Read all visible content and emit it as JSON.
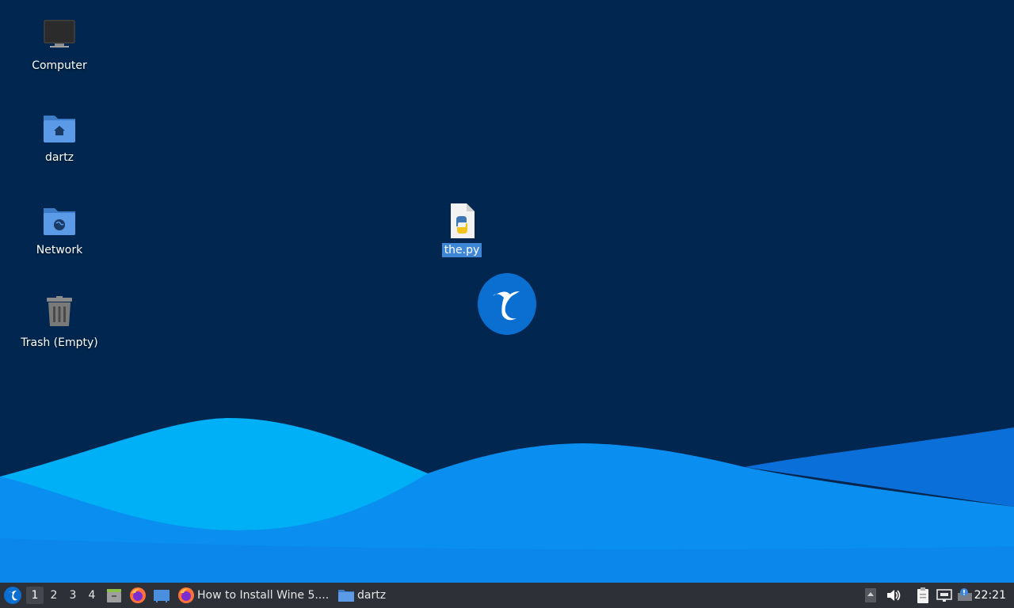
{
  "desktop": {
    "icons": [
      {
        "label": "Computer",
        "icon": "computer-icon"
      },
      {
        "label": "dartz",
        "icon": "home-folder-icon"
      },
      {
        "label": "Network",
        "icon": "network-folder-icon"
      },
      {
        "label": "Trash (Empty)",
        "icon": "trash-icon"
      },
      {
        "label": "the.py",
        "icon": "python-file-icon",
        "selected": true
      }
    ],
    "logo": "hummingbird-logo-icon",
    "colors": {
      "background": "#01264f",
      "wave_light": "#00aaf5",
      "wave_mid": "#0a8ff0",
      "selection": "#3f86d6"
    }
  },
  "taskbar": {
    "menu_icon": "whisker-menu-icon",
    "workspaces": [
      "1",
      "2",
      "3",
      "4"
    ],
    "active_workspace": "1",
    "launchers": [
      "file-manager-launcher-icon",
      "firefox-launcher-icon",
      "show-desktop-icon"
    ],
    "tasks": [
      {
        "label": "How to Install Wine 5....",
        "icon": "firefox-icon"
      },
      {
        "label": "dartz",
        "icon": "folder-icon"
      }
    ],
    "tray": [
      "tray-expand-icon",
      "volume-icon",
      "clipboard-icon",
      "network-wired-icon",
      "notification-icon"
    ],
    "clock": "22:21"
  }
}
